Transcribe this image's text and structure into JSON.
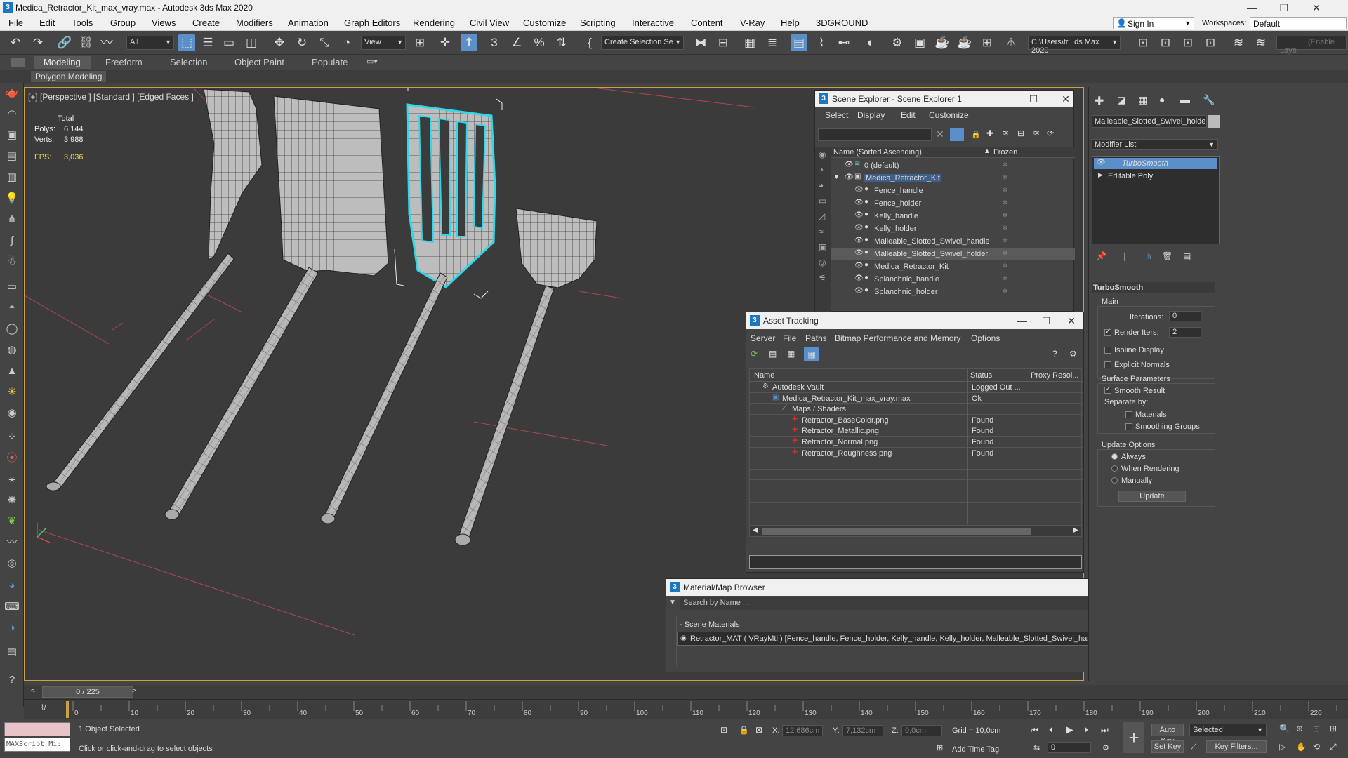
{
  "window": {
    "title": "Medica_Retractor_Kit_max_vray.max - Autodesk 3ds Max 2020",
    "app_icon": "3",
    "controls": [
      "—",
      "❐",
      "✕"
    ]
  },
  "menu": [
    "File",
    "Edit",
    "Tools",
    "Group",
    "Views",
    "Create",
    "Modifiers",
    "Animation",
    "Graph Editors",
    "Rendering",
    "Civil View",
    "Customize",
    "Scripting",
    "Interactive",
    "Content",
    "V-Ray",
    "Help",
    "3DGROUND"
  ],
  "account": {
    "sign_in": "Sign In",
    "workspaces_label": "Workspaces:",
    "workspace": "Default"
  },
  "toolbar": {
    "selection_filter": "All",
    "ref_coord": "View",
    "named_sel": "Create Selection Se",
    "project_path": "C:\\Users\\tr...ds Max 2020",
    "enable_layer": "(Enable Laye"
  },
  "ribbon": {
    "tabs": [
      "Modeling",
      "Freeform",
      "Selection",
      "Object Paint",
      "Populate"
    ],
    "active": "Modeling",
    "sub": "Polygon Modeling"
  },
  "viewport": {
    "label": "[+] [Perspective ] [Standard ] [Edged Faces ]",
    "stats": {
      "total": "Total",
      "polys_label": "Polys:",
      "polys": "6 144",
      "verts_label": "Verts:",
      "verts": "3 988",
      "fps_label": "FPS:",
      "fps": "3,036"
    }
  },
  "scene_explorer": {
    "title": "Scene Explorer - Scene Explorer 1",
    "menu": [
      "Select",
      "Display",
      "Edit",
      "Customize"
    ],
    "col_name": "Name (Sorted Ascending)",
    "col_frozen": "Frozen",
    "items": [
      {
        "name": "0 (default)",
        "level": 1
      },
      {
        "name": "Medica_Retractor_Kit",
        "level": 1,
        "selected_text": true
      },
      {
        "name": "Fence_handle",
        "level": 2
      },
      {
        "name": "Fence_holder",
        "level": 2
      },
      {
        "name": "Kelly_handle",
        "level": 2
      },
      {
        "name": "Kelly_holder",
        "level": 2
      },
      {
        "name": "Malleable_Slotted_Swivel_handle",
        "level": 2
      },
      {
        "name": "Malleable_Slotted_Swivel_holder",
        "level": 2,
        "highlight": true
      },
      {
        "name": "Medica_Retractor_Kit",
        "level": 2
      },
      {
        "name": "Splanchnic_handle",
        "level": 2
      },
      {
        "name": "Splanchnic_holder",
        "level": 2
      }
    ]
  },
  "asset_tracking": {
    "title": "Asset Tracking",
    "menu": [
      "Server",
      "File",
      "Paths",
      "Bitmap Performance and Memory",
      "Options"
    ],
    "columns": [
      "Name",
      "Status",
      "Proxy Resol..."
    ],
    "rows": [
      {
        "name": "Autodesk Vault",
        "status": "Logged Out ...",
        "indent": 0
      },
      {
        "name": "Medica_Retractor_Kit_max_vray.max",
        "status": "Ok",
        "indent": 1
      },
      {
        "name": "Maps / Shaders",
        "status": "",
        "indent": 2
      },
      {
        "name": "Retractor_BaseColor.png",
        "status": "Found",
        "indent": 3
      },
      {
        "name": "Retractor_Metallic.png",
        "status": "Found",
        "indent": 3
      },
      {
        "name": "Retractor_Normal.png",
        "status": "Found",
        "indent": 3
      },
      {
        "name": "Retractor_Roughness.png",
        "status": "Found",
        "indent": 3
      }
    ]
  },
  "command_panel": {
    "object_name": "Malleable_Slotted_Swivel_holde",
    "modifier_list": "Modifier List",
    "stack": [
      "TurboSmooth",
      "Editable Poly"
    ],
    "rollout": "TurboSmooth",
    "main": "Main",
    "iterations_label": "Iterations:",
    "iterations": "0",
    "render_iters_label": "Render Iters:",
    "render_iters": "2",
    "isoline": "Isoline Display",
    "explicit_normals": "Explicit Normals",
    "surface_params": "Surface Parameters",
    "smooth_result": "Smooth Result",
    "separate_by": "Separate by:",
    "materials": "Materials",
    "smoothing_groups": "Smoothing Groups",
    "update_options": "Update Options",
    "always": "Always",
    "when_rendering": "When Rendering",
    "manually": "Manually",
    "update_btn": "Update"
  },
  "material_browser": {
    "title": "Material/Map Browser",
    "search_placeholder": "Search by Name ...",
    "section": "- Scene Materials",
    "entry": "Retractor_MAT ( VRayMtl ) [Fence_handle, Fence_holder, Kelly_handle, Kelly_holder, Malleable_Slotted_Swivel_handle, Malleable_Slotted_Swivel_holder, Splanchnic_han..."
  },
  "timeline": {
    "frame": "0 / 225",
    "ticks": [
      "0",
      "10",
      "20",
      "30",
      "40",
      "50",
      "60",
      "70",
      "80",
      "90",
      "100",
      "110",
      "120",
      "130",
      "140",
      "150",
      "160",
      "170",
      "180",
      "190",
      "200",
      "210",
      "220"
    ]
  },
  "status": {
    "maxscript": "MAXScript Mi:",
    "selected": "1 Object Selected",
    "hint": "Click or click-and-drag to select objects",
    "x_label": "X:",
    "x": "12,686cm",
    "y_label": "Y:",
    "y": "7,132cm",
    "z_label": "Z:",
    "z": "0,0cm",
    "grid": "Grid = 10,0cm",
    "add_time_tag": "Add Time Tag",
    "auto_key": "Auto Key",
    "set_key": "Set Key",
    "selected_set": "Selected",
    "key_filters": "Key Filters...",
    "frame_field": "0"
  },
  "colors": {
    "accent": "#5b8fc9",
    "viewport_border": "#c8a14a",
    "selection": "#2fd8e8",
    "stat_yellow": "#f2d24a"
  }
}
